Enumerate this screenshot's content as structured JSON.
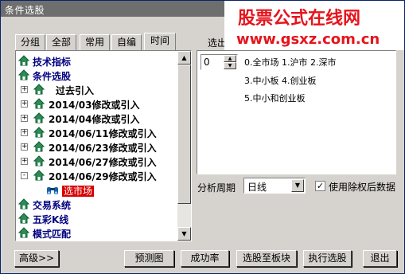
{
  "window": {
    "title": "条件选股"
  },
  "watermark": {
    "line1": "股票公式在线网",
    "line2": "www.gsxz.com.cn",
    "color": "#e6141c"
  },
  "tabs": [
    "分组",
    "全部",
    "常用",
    "自编",
    "时间"
  ],
  "active_tab": "时间",
  "right_header_label": "选出",
  "tree": {
    "nodes": [
      {
        "label": "技术指标",
        "level": 0,
        "expander": "",
        "icon": "house-icon"
      },
      {
        "label": "条件选股",
        "level": 0,
        "expander": "",
        "icon": "house-icon"
      },
      {
        "label": "过去引入",
        "level": 1,
        "expander": "+",
        "icon": "house-icon"
      },
      {
        "label": "2014/03修改或引入",
        "level": 1,
        "expander": "+",
        "icon": "house-icon"
      },
      {
        "label": "2014/04修改或引入",
        "level": 1,
        "expander": "+",
        "icon": "house-icon"
      },
      {
        "label": "2014/06/11修改或引入",
        "level": 1,
        "expander": "+",
        "icon": "house-icon"
      },
      {
        "label": "2014/06/23修改或引入",
        "level": 1,
        "expander": "+",
        "icon": "house-icon"
      },
      {
        "label": "2014/06/27修改或引入",
        "level": 1,
        "expander": "+",
        "icon": "house-icon"
      },
      {
        "label": "2014/06/29修改或引入",
        "level": 1,
        "expander": "-",
        "icon": "house-icon"
      },
      {
        "label": "选市场",
        "level": 2,
        "expander": "",
        "icon": "binoculars-icon",
        "selected": true
      },
      {
        "label": "交易系统",
        "level": 0,
        "expander": "",
        "icon": "house-icon"
      },
      {
        "label": "五彩K线",
        "level": 0,
        "expander": "",
        "icon": "house-icon"
      },
      {
        "label": "模式匹配",
        "level": 0,
        "expander": "",
        "icon": "house-icon"
      }
    ]
  },
  "params": {
    "spin_value": "0",
    "options": [
      "0.全市场 1.沪市 2.深市",
      "3.中小板 4.创业板",
      "5.中小和创业板"
    ]
  },
  "period": {
    "label": "分析周期",
    "value": "日线"
  },
  "exright": {
    "label": "使用除权后数据",
    "checked": "✓"
  },
  "buttons": {
    "advanced": "高级>>",
    "preview": "预测图",
    "success_rate": "成功率",
    "to_block": "选股至板块",
    "execute": "执行选股",
    "exit": "退出"
  }
}
